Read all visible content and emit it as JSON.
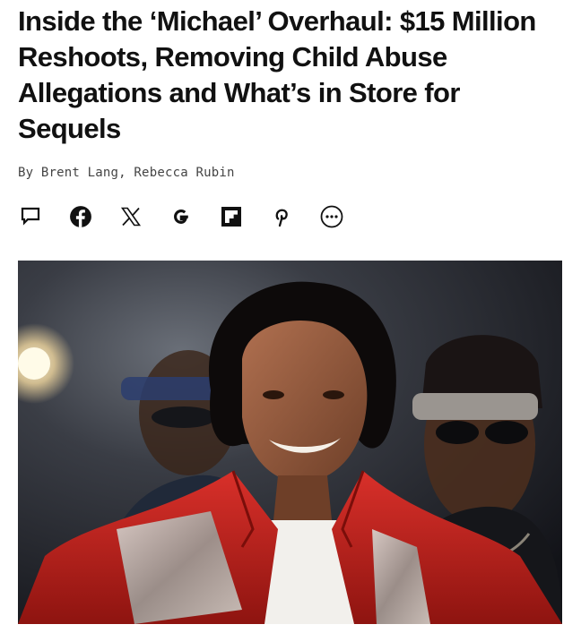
{
  "article": {
    "headline": "Inside the ‘Michael’ Overhaul: $15 Million Reshoots, Removing Child Abuse Allegations and What’s in Store for Sequels",
    "byline": "By Brent Lang, Rebecca Rubin"
  },
  "share": {
    "buttons": [
      {
        "icon": "comment-icon"
      },
      {
        "icon": "facebook-icon"
      },
      {
        "icon": "x-icon"
      },
      {
        "icon": "google-icon"
      },
      {
        "icon": "flipboard-icon"
      },
      {
        "icon": "pinterest-icon"
      },
      {
        "icon": "more-options-icon"
      }
    ]
  },
  "hero": {
    "description_icon": "photo",
    "colors": {
      "jacket": "#c8231e",
      "background": "#1a1c22"
    }
  }
}
